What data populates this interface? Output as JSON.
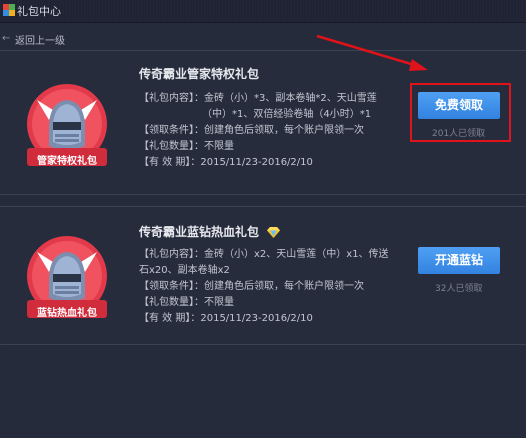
{
  "window": {
    "title": "礼包中心",
    "icon": "gift-center-icon"
  },
  "nav": {
    "back_label": "返回上一级"
  },
  "accent": {
    "button": "#3b8ff0",
    "badge_red": "#e23a4a",
    "highlight": "#e0121a"
  },
  "gifts": [
    {
      "title": "传奇霸业管家特权礼包",
      "badge_label": "管家特权礼包",
      "contents_label": "【礼包内容】：",
      "contents_line1": "金砖（小）*3、副本卷轴*2、天山雪莲",
      "contents_line2": "（中）*1、双倍经验卷轴（4小时）*1",
      "condition": "【领取条件】：创建角色后领取，每个账户限领一次",
      "quantity": "【礼包数量】：不限量",
      "validity": "【有 效 期】：2015/11/23-2016/2/10",
      "button_label": "免费领取",
      "claimed_count": "201人已领取"
    },
    {
      "title": "传奇霸业蓝钻热血礼包",
      "badge_label": "蓝钻热血礼包",
      "contents_label": "【礼包内容】：",
      "contents_line1": "金砖（小）x2、天山雪莲（中）x1、传送",
      "contents_line2": "石x20、副本卷轴x2",
      "condition": "【领取条件】：创建角色后领取，每个账户限领一次",
      "quantity": "【礼包数量】：不限量",
      "validity": "【有 效 期】：2015/11/23-2016/2/10",
      "button_label": "开通蓝钻",
      "claimed_count": "32人已领取"
    }
  ]
}
